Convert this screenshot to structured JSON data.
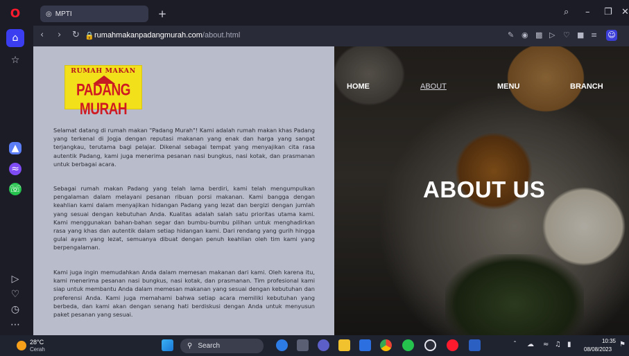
{
  "browser": {
    "tab_title": "MPTI",
    "new_tab": "+",
    "url_domain": "rumahmakanpadangmurah.com",
    "url_path": "/about.html",
    "window_controls": {
      "search": "⌕",
      "minimize": "–",
      "restore": "❐",
      "close": "✕"
    }
  },
  "site": {
    "logo_top": "RUMAH MAKAN",
    "logo_bottom": "PADANG MURAH",
    "nav": {
      "home": "HOME",
      "about": "ABOUT",
      "menu": "MENU",
      "branch": "BRANCH"
    },
    "hero_title": "ABOUT US",
    "paragraphs": [
      "Selamat datang di rumah makan \"Padang Murah\"! Kami adalah rumah makan khas Padang yang terkenal di Jogja dengan reputasi makanan yang enak dan harga yang sangat terjangkau, terutama bagi pelajar. Dikenal sebagai tempat yang menyajikan cita rasa autentik Padang, kami juga menerima pesanan nasi bungkus, nasi kotak, dan prasmanan untuk berbagai acara.",
      "Sebagai rumah makan Padang yang telah lama berdiri, kami telah mengumpulkan pengalaman dalam melayani pesanan ribuan porsi makanan. Kami bangga dengan keahlian kami dalam menyajikan hidangan Padang yang lezat dan bergizi dengan jumlah yang sesuai dengan kebutuhan Anda. Kualitas adalah salah satu prioritas utama kami. Kami menggunakan bahan-bahan segar dan bumbu-bumbu pilihan untuk menghadirkan rasa yang khas dan autentik dalam setiap hidangan kami. Dari rendang yang gurih hingga gulai ayam yang lezat, semuanya dibuat dengan penuh keahlian oleh tim kami yang berpengalaman.",
      "Kami juga ingin memudahkan Anda dalam memesan makanan dari kami. Oleh karena itu, kami menerima pesanan nasi bungkus, nasi kotak, dan prasmanan. Tim profesional kami siap untuk membantu Anda dalam memesan makanan yang sesuai dengan kebutuhan dan preferensi Anda. Kami juga memahami bahwa setiap acara memiliki kebutuhan yang berbeda, dan kami akan dengan senang hati berdiskusi dengan Anda untuk menyusun paket pesanan yang sesuai."
    ]
  },
  "taskbar": {
    "weather_temp": "28°C",
    "weather_desc": "Cerah",
    "search_placeholder": "Search",
    "time": "10:35",
    "date": "08/08/2023"
  },
  "colors": {
    "accent": "#e21b2c",
    "logo_bg": "#f2e01a",
    "left_pane": "#b9bccb"
  }
}
